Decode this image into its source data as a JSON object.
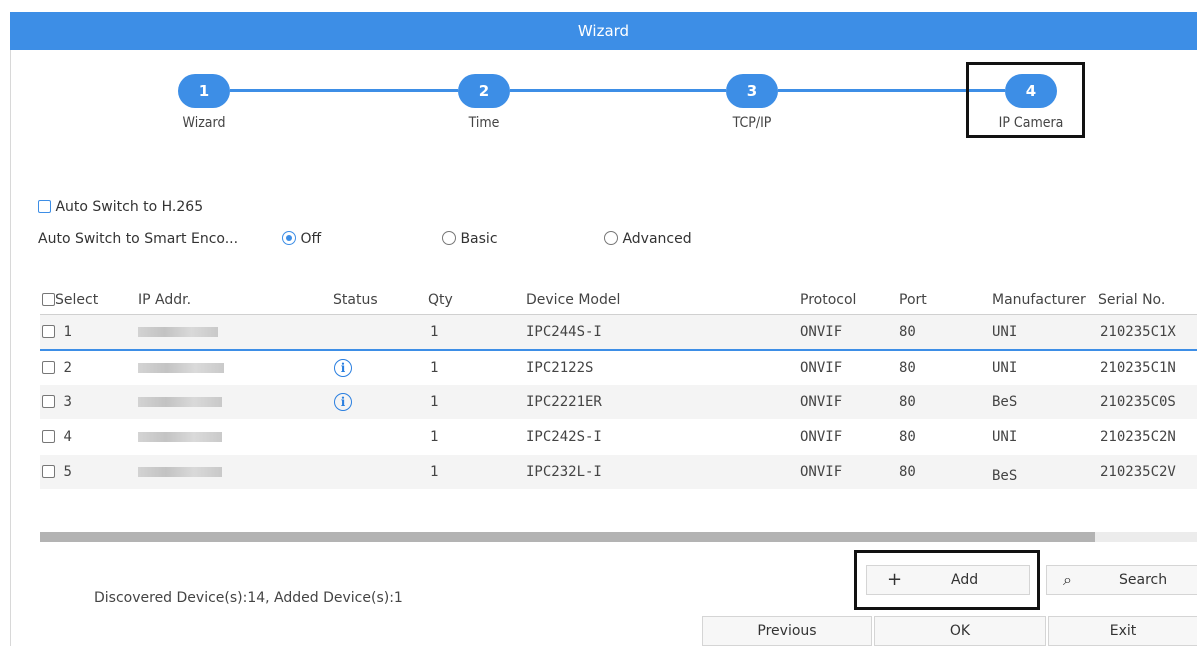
{
  "window": {
    "title": "Wizard"
  },
  "steps": [
    {
      "num": "1",
      "label": "Wizard"
    },
    {
      "num": "2",
      "label": "Time"
    },
    {
      "num": "3",
      "label": "TCP/IP"
    },
    {
      "num": "4",
      "label": "IP Camera"
    }
  ],
  "options": {
    "auto_h265": "Auto Switch to H.265",
    "smart_label": "Auto Switch to Smart Enco...",
    "smart_off": "Off",
    "smart_basic": "Basic",
    "smart_advanced": "Advanced",
    "smart_selected": "Off"
  },
  "table": {
    "headers": {
      "select": "Select",
      "ip": "IP Addr.",
      "status": "Status",
      "qty": "Qty",
      "model": "Device Model",
      "protocol": "Protocol",
      "port": "Port",
      "manufacturer": "Manufacturer",
      "serial": "Serial No."
    },
    "rows": [
      {
        "index": "1",
        "qty": "1",
        "model": "IPC244S-I",
        "protocol": "ONVIF",
        "port": "80",
        "manufacturer": "UNI",
        "serial": "210235C1X"
      },
      {
        "index": "2",
        "qty": "1",
        "model": "IPC2122S",
        "protocol": "ONVIF",
        "port": "80",
        "manufacturer": "UNI",
        "serial": "210235C1N"
      },
      {
        "index": "3",
        "qty": "1",
        "model": "IPC2221ER",
        "protocol": "ONVIF",
        "port": "80",
        "manufacturer": "BeS",
        "serial": "210235C0S"
      },
      {
        "index": "4",
        "qty": "1",
        "model": "IPC242S-I",
        "protocol": "ONVIF",
        "port": "80",
        "manufacturer": "UNI",
        "serial": "210235C2N"
      },
      {
        "index": "5",
        "qty": "1",
        "model": "IPC232L-I",
        "protocol": "ONVIF",
        "port": "80",
        "manufacturer": "BeS",
        "serial": "210235C2V"
      }
    ],
    "status_icon": "i"
  },
  "footer": {
    "summary": "Discovered Device(s):14, Added Device(s):1",
    "add_icon": "+",
    "add_label": "Add",
    "search_icon": "⌕",
    "search_label": "Search",
    "previous_label": "Previous",
    "ok_label": "OK",
    "exit_label": "Exit"
  },
  "colors": {
    "accent": "#3d8ee6",
    "highlight": "#111111"
  }
}
